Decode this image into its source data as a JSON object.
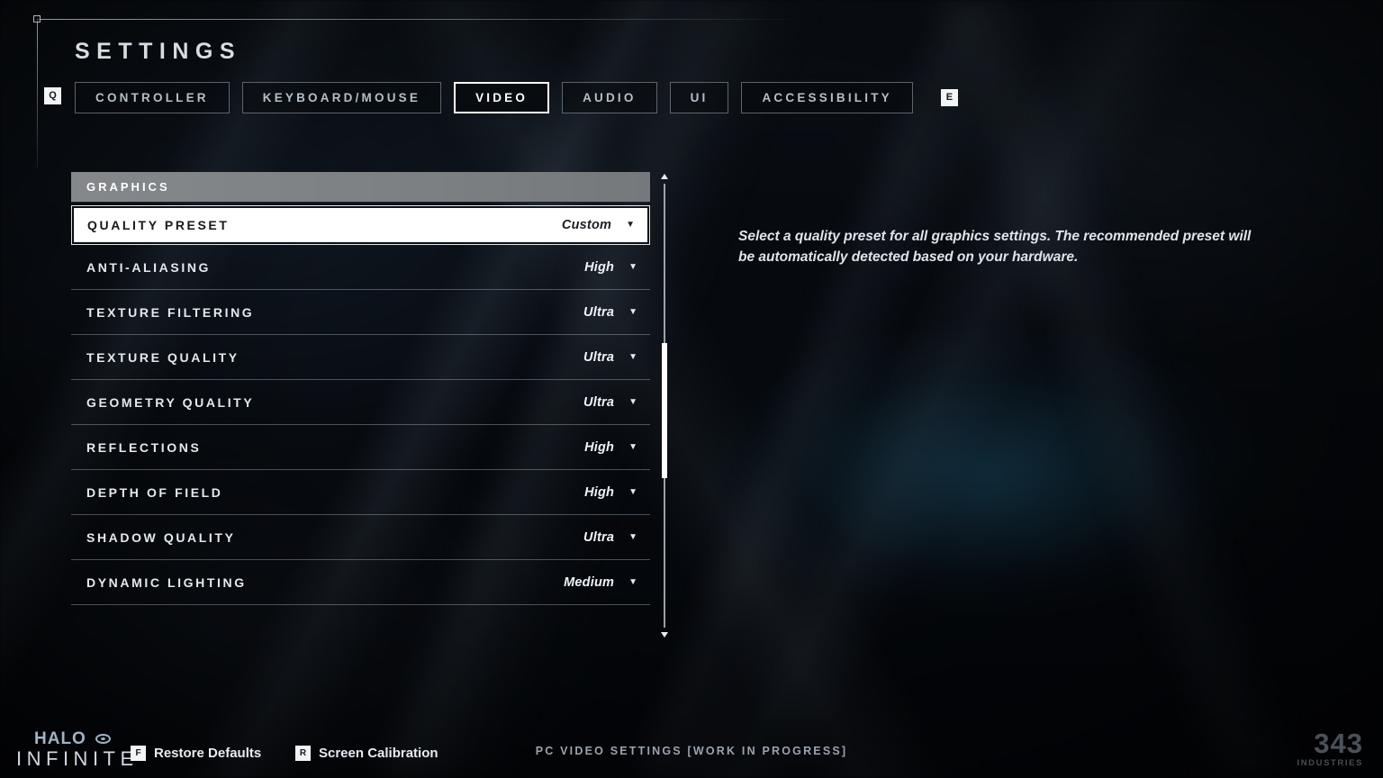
{
  "header": {
    "title": "SETTINGS",
    "prev_tab_key": "Q",
    "next_tab_key": "E"
  },
  "tabs": [
    {
      "label": "CONTROLLER",
      "selected": false
    },
    {
      "label": "KEYBOARD/MOUSE",
      "selected": false
    },
    {
      "label": "VIDEO",
      "selected": true
    },
    {
      "label": "AUDIO",
      "selected": false
    },
    {
      "label": "UI",
      "selected": false
    },
    {
      "label": "ACCESSIBILITY",
      "selected": false
    }
  ],
  "section": {
    "title": "GRAPHICS"
  },
  "settings": [
    {
      "label": "QUALITY PRESET",
      "value": "Custom",
      "chevron": "▼",
      "selected": true
    },
    {
      "label": "ANTI-ALIASING",
      "value": "High",
      "chevron": "▼",
      "selected": false
    },
    {
      "label": "TEXTURE FILTERING",
      "value": "Ultra",
      "chevron": "▼",
      "selected": false
    },
    {
      "label": "TEXTURE QUALITY",
      "value": "Ultra",
      "chevron": "▼",
      "selected": false
    },
    {
      "label": "GEOMETRY QUALITY",
      "value": "Ultra",
      "chevron": "▼",
      "selected": false
    },
    {
      "label": "REFLECTIONS",
      "value": "High",
      "chevron": "▼",
      "selected": false
    },
    {
      "label": "DEPTH OF FIELD",
      "value": "High",
      "chevron": "▼",
      "selected": false
    },
    {
      "label": "SHADOW QUALITY",
      "value": "Ultra",
      "chevron": "▼",
      "selected": false
    },
    {
      "label": "DYNAMIC LIGHTING",
      "value": "Medium",
      "chevron": "▼",
      "selected": false
    }
  ],
  "description": "Select a quality preset for all graphics settings. The recommended preset will be automatically detected based on your hardware.",
  "footer": {
    "logo_primary": "HALO",
    "logo_secondary": "INFINITE",
    "restore_key": "F",
    "restore_label": "Restore Defaults",
    "calibration_key": "R",
    "calibration_label": "Screen Calibration",
    "center_note": "PC VIDEO SETTINGS [WORK IN PROGRESS]",
    "studio_number": "343",
    "studio_sub": "INDUSTRIES"
  },
  "colors": {
    "accent_white": "#ffffff",
    "section_gray": "#7d8184",
    "text_primary": "#e4e9ee",
    "text_muted": "#9aa4ae",
    "halo_blue": "#9fb4c9"
  }
}
